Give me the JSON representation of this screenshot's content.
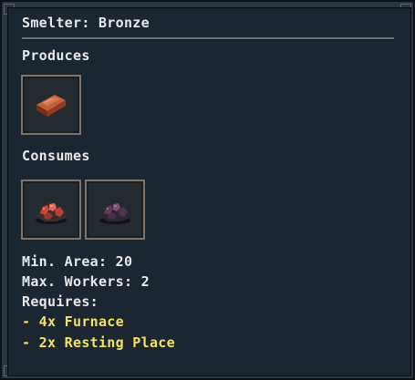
{
  "tooltip": {
    "title": "Smelter: Bronze",
    "produces_label": "Produces",
    "consumes_label": "Consumes",
    "produces": [
      {
        "icon": "bronze-ingot-icon",
        "color": "#a4482e"
      }
    ],
    "consumes": [
      {
        "icon": "copper-ore-icon",
        "color": "#c2513f"
      },
      {
        "icon": "tin-ore-icon",
        "color": "#5a3a52"
      }
    ],
    "stats": [
      {
        "label": "Min. Area: 20"
      },
      {
        "label": "Max. Workers: 2"
      },
      {
        "label": "Requires:"
      }
    ],
    "requirements": [
      {
        "label": "- 4x Furnace"
      },
      {
        "label": "- 2x Resting Place"
      }
    ],
    "colors": {
      "panel_bg": "#1b2630",
      "frame": "#2a3640",
      "text": "#e8e8e8",
      "requirement_text": "#f2e35e",
      "slot_border": "#7d7368"
    }
  }
}
